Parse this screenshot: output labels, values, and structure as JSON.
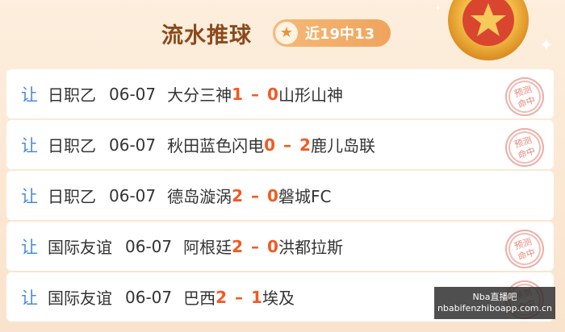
{
  "header": {
    "title": "流水推球",
    "badge_text": "近19中13"
  },
  "rows": [
    {
      "tag": "让",
      "league": "日职乙",
      "date": "06-07",
      "home": "大分三神",
      "home_score": "1",
      "dash": "–",
      "away_score": "0",
      "away": "山形山神",
      "stamp": true
    },
    {
      "tag": "让",
      "league": "日职乙",
      "date": "06-07",
      "home": "秋田蓝色闪电",
      "home_score": "0",
      "dash": "–",
      "away_score": "2",
      "away": "鹿儿岛联",
      "stamp": true
    },
    {
      "tag": "让",
      "league": "日职乙",
      "date": "06-07",
      "home": "德岛漩涡",
      "home_score": "2",
      "dash": "–",
      "away_score": "0",
      "away": "磐城FC",
      "stamp": false
    },
    {
      "tag": "让",
      "league": "国际友谊",
      "date": "06-07",
      "home": "阿根廷",
      "home_score": "2",
      "dash": "–",
      "away_score": "0",
      "away": "洪都拉斯",
      "stamp": true
    },
    {
      "tag": "让",
      "league": "国际友谊",
      "date": "06-07",
      "home": "巴西",
      "home_score": "2",
      "dash": "–",
      "away_score": "1",
      "away": "埃及",
      "stamp": true
    }
  ],
  "stamp_text": {
    "line1": "预测",
    "line2": "命中"
  },
  "watermark": {
    "line1": "Nba直播吧",
    "line2": "nbabifenzhiboapp.com.cn"
  },
  "colors": {
    "title": "#8a4a1c",
    "tag": "#4a8ad6",
    "score": "#f25a22",
    "stamp": "#e06a5c"
  }
}
